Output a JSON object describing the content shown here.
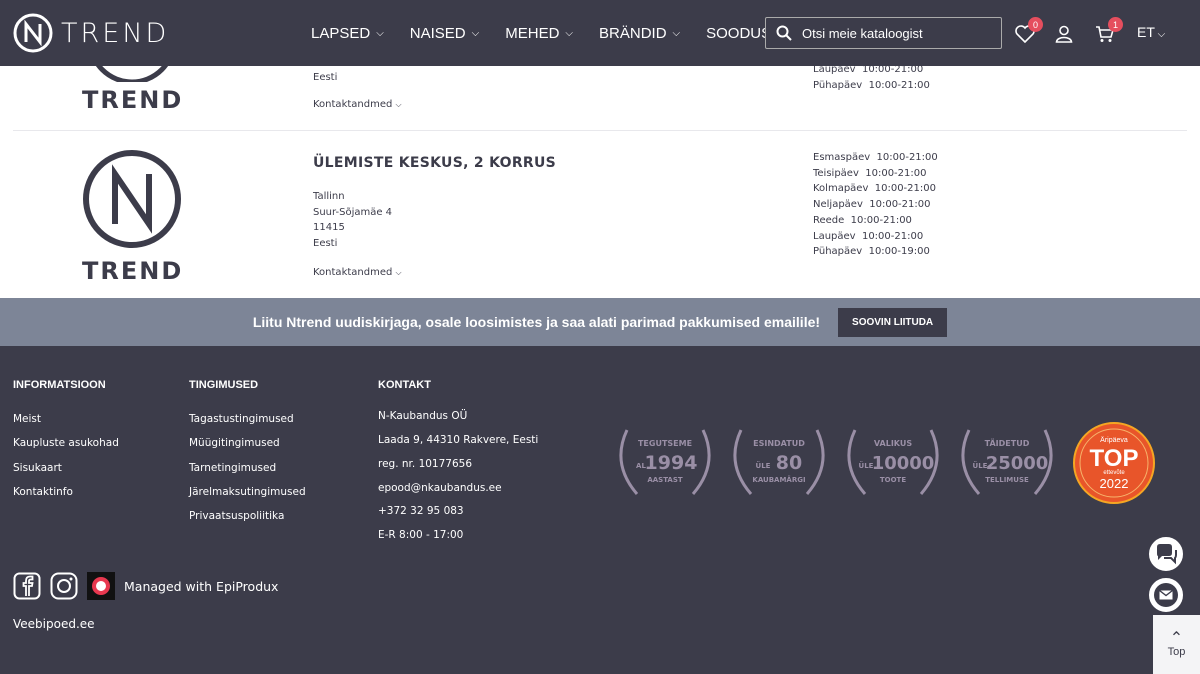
{
  "header": {
    "brand": "TREND",
    "nav": [
      {
        "label": "LAPSED"
      },
      {
        "label": "NAISED"
      },
      {
        "label": "MEHED"
      },
      {
        "label": "BRÄNDID"
      },
      {
        "label": "SOODUS"
      }
    ],
    "search_placeholder": "Otsi meie kataloogist",
    "wishlist_count": "0",
    "cart_count": "1",
    "language": "ET"
  },
  "stores": [
    {
      "logo_text": "TREND",
      "country": "Eesti",
      "contact_label": "Kontaktandmed",
      "hours": [
        {
          "day": "Laupäev",
          "time": "10:00-21:00"
        },
        {
          "day": "Pühapäev",
          "time": "10:00-21:00"
        }
      ]
    },
    {
      "logo_text": "TREND",
      "title": "ÜLEMISTE KESKUS, 2 KORRUS",
      "address": [
        "Tallinn",
        "Suur-Sõjamäe 4",
        "11415",
        "Eesti"
      ],
      "contact_label": "Kontaktandmed",
      "hours": [
        {
          "day": "Esmaspäev",
          "time": "10:00-21:00"
        },
        {
          "day": "Teisipäev",
          "time": "10:00-21:00"
        },
        {
          "day": "Kolmapäev",
          "time": "10:00-21:00"
        },
        {
          "day": "Neljapäev",
          "time": "10:00-21:00"
        },
        {
          "day": "Reede",
          "time": "10:00-21:00"
        },
        {
          "day": "Laupäev",
          "time": "10:00-21:00"
        },
        {
          "day": "Pühapäev",
          "time": "10:00-19:00"
        }
      ]
    }
  ],
  "newsletter": {
    "text": "Liitu Ntrend uudiskirjaga, osale loosimistes ja saa alati parimad pakkumised emailile!",
    "button": "SOOVIN LIITUDA"
  },
  "footer": {
    "info": {
      "title": "INFORMATSIOON",
      "links": [
        "Meist",
        "Kaupluste asukohad",
        "Sisukaart",
        "Kontaktinfo"
      ]
    },
    "terms": {
      "title": "TINGIMUSED",
      "links": [
        "Tagastustingimused",
        "Müügitingimused",
        "Tarnetingimused",
        "Järelmaksutingimused",
        "Privaatsuspoliitika"
      ]
    },
    "contact": {
      "title": "KONTAKT",
      "lines": [
        "N-Kaubandus OÜ",
        "Laada 9, 44310 Rakvere, Eesti",
        "reg. nr. 10177656",
        "epood@nkaubandus.ee",
        "+372 32 95 083",
        "E-R 8:00 - 17:00"
      ]
    },
    "badges": [
      {
        "top": "TEGUTSEME",
        "pre": "AL",
        "num": "1994",
        "bottom": "AASTAST"
      },
      {
        "top": "ESINDATUD",
        "pre": "ÜLE",
        "num": "80",
        "bottom": "KAUBAMÄRGI"
      },
      {
        "top": "VALIKUS",
        "pre": "ÜLE",
        "num": "10000",
        "bottom": "TOOTE"
      },
      {
        "top": "TÄIDETUD",
        "pre": "ÜLE",
        "num": "25000",
        "bottom": "TELLIMUSE"
      }
    ],
    "award": {
      "top": "Äripäeva",
      "main": "TOP",
      "sub": "ettevõte",
      "year": "2022"
    },
    "managed": "Managed with EpiProdux",
    "veebipoed": "Veebipoed.ee",
    "top_label": "Top"
  },
  "colors": {
    "dark": "#3c3c4a",
    "newsletter": "#7d8597",
    "badge_red": "#e54e5e",
    "badge_purple": "#9a8fa6",
    "award_orange": "#e8552a"
  }
}
